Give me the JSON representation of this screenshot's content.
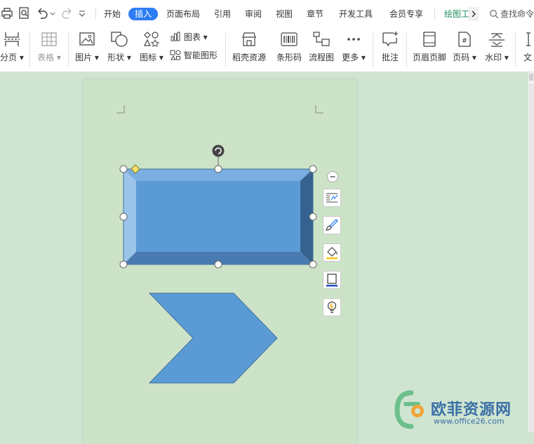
{
  "menu_tabs": [
    {
      "label": "开始"
    },
    {
      "label": "插入"
    },
    {
      "label": "页面布局"
    },
    {
      "label": "引用"
    },
    {
      "label": "审阅"
    },
    {
      "label": "视图"
    },
    {
      "label": "章节"
    },
    {
      "label": "开发工具"
    },
    {
      "label": "会员专享"
    },
    {
      "label": "绘图工"
    }
  ],
  "search": {
    "label": "查找命令"
  },
  "ribbon": {
    "page_break": "分页",
    "table": "表格",
    "picture": "图片",
    "shape": "形状",
    "icon": "图标",
    "chart": "图表",
    "smart_graphic": "智能图形",
    "docer_resources": "稻壳资源",
    "barcode": "条形码",
    "flowchart": "流程图",
    "more": "更多",
    "comment": "批注",
    "header_footer": "页眉页脚",
    "page_number": "页码",
    "watermark": "水印",
    "text_partial": "文"
  },
  "colors": {
    "accent": "#2f7df5",
    "shape_fill": "#5b9bd5",
    "shape_dark": "#41719c",
    "background": "#cfe5d1",
    "page": "#cde3c8"
  },
  "watermark": {
    "text": "欧菲资源网",
    "url": "www.office26.com"
  }
}
